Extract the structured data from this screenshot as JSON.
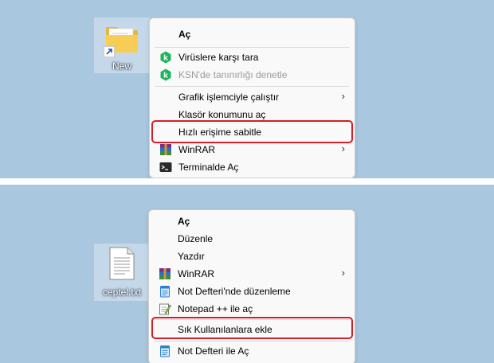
{
  "top_panel": {
    "desktop_icon": {
      "label": "New",
      "icon": "folder-shortcut-icon"
    },
    "context_menu": {
      "items": [
        {
          "label": "Aç",
          "icon": ""
        },
        {
          "label": "Virüslere karşı tara",
          "icon": "kaspersky-icon"
        },
        {
          "label": "KSN'de tanınırlığı denetle",
          "icon": "kaspersky-icon"
        },
        {
          "label": "Grafik işlemciyle çalıştır",
          "icon": "",
          "submenu": "›"
        },
        {
          "label": "Klasör konumunu aç",
          "icon": ""
        },
        {
          "label": "Hızlı erişime sabitle",
          "icon": ""
        },
        {
          "label": "WinRAR",
          "icon": "winrar-icon",
          "submenu": "›"
        },
        {
          "label": "Terminalde Aç",
          "icon": "terminal-icon"
        }
      ]
    }
  },
  "bottom_panel": {
    "desktop_icon": {
      "label": "ceptel.txt",
      "icon": "text-file-icon"
    },
    "context_menu": {
      "items": [
        {
          "label": "Aç",
          "icon": ""
        },
        {
          "label": "Düzenle",
          "icon": ""
        },
        {
          "label": "Yazdır",
          "icon": ""
        },
        {
          "label": "WinRAR",
          "icon": "winrar-icon",
          "submenu": "›"
        },
        {
          "label": "Not Defteri'nde düzenleme",
          "icon": "notepad-icon"
        },
        {
          "label": "Notepad ++ ile aç",
          "icon": "notepadpp-icon"
        },
        {
          "label": "Sık Kullanılanlara ekle",
          "icon": ""
        },
        {
          "label": "Not Defteri ile Aç",
          "icon": "notepad-icon"
        }
      ]
    }
  },
  "colors": {
    "desktop_background": "#a9c7de",
    "menu_background": "#f9f9f9",
    "highlight_border": "#d41f2a",
    "kaspersky_green": "#1bb55c"
  }
}
